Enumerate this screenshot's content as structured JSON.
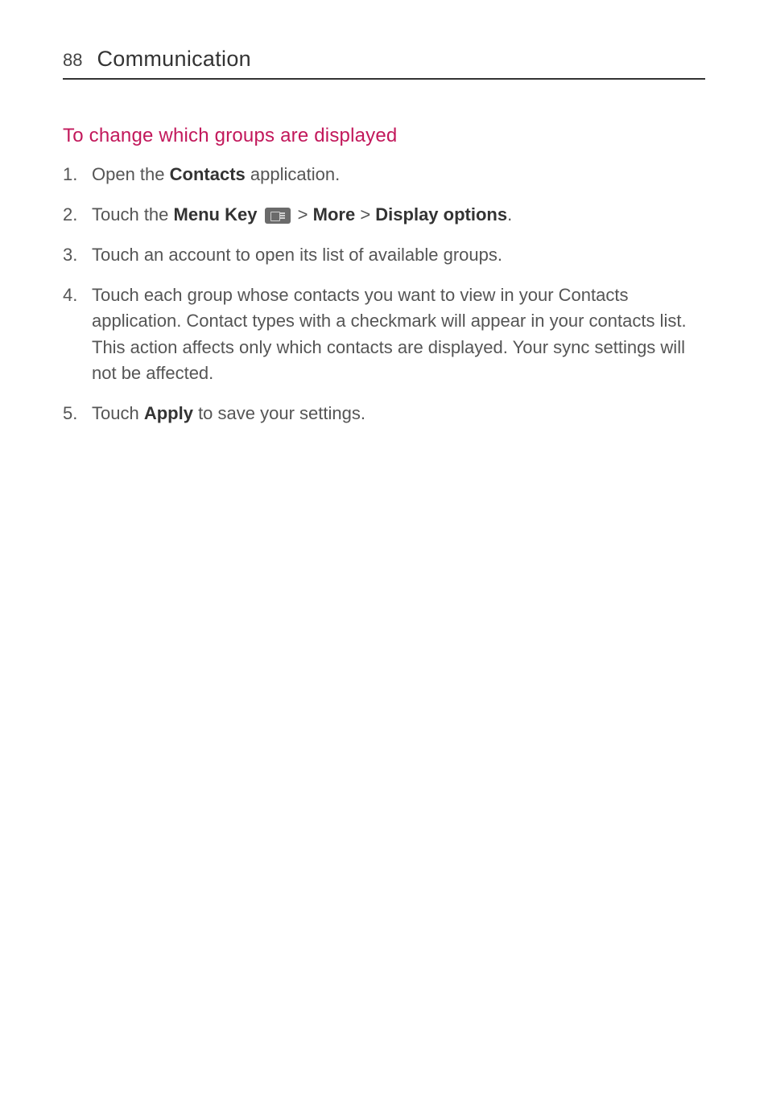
{
  "header": {
    "page_number": "88",
    "chapter_title": "Communication"
  },
  "section": {
    "title": "To change which groups are displayed"
  },
  "steps": {
    "s1": {
      "t1": "Open the ",
      "b1": "Contacts",
      "t2": " application."
    },
    "s2": {
      "t1": "Touch the ",
      "b1": "Menu Key",
      "t2": " > ",
      "b2": "More",
      "t3": " > ",
      "b3": "Display options",
      "t4": "."
    },
    "s3": {
      "t1": "Touch an account to open its list of available groups."
    },
    "s4": {
      "t1": "Touch each group whose contacts you want to view in your Contacts application. Contact types with a checkmark will appear in your contacts list.",
      "t2": "This action affects only which contacts are displayed. Your sync settings will not be affected."
    },
    "s5": {
      "t1": "Touch ",
      "b1": "Apply",
      "t2": " to save your settings."
    }
  }
}
